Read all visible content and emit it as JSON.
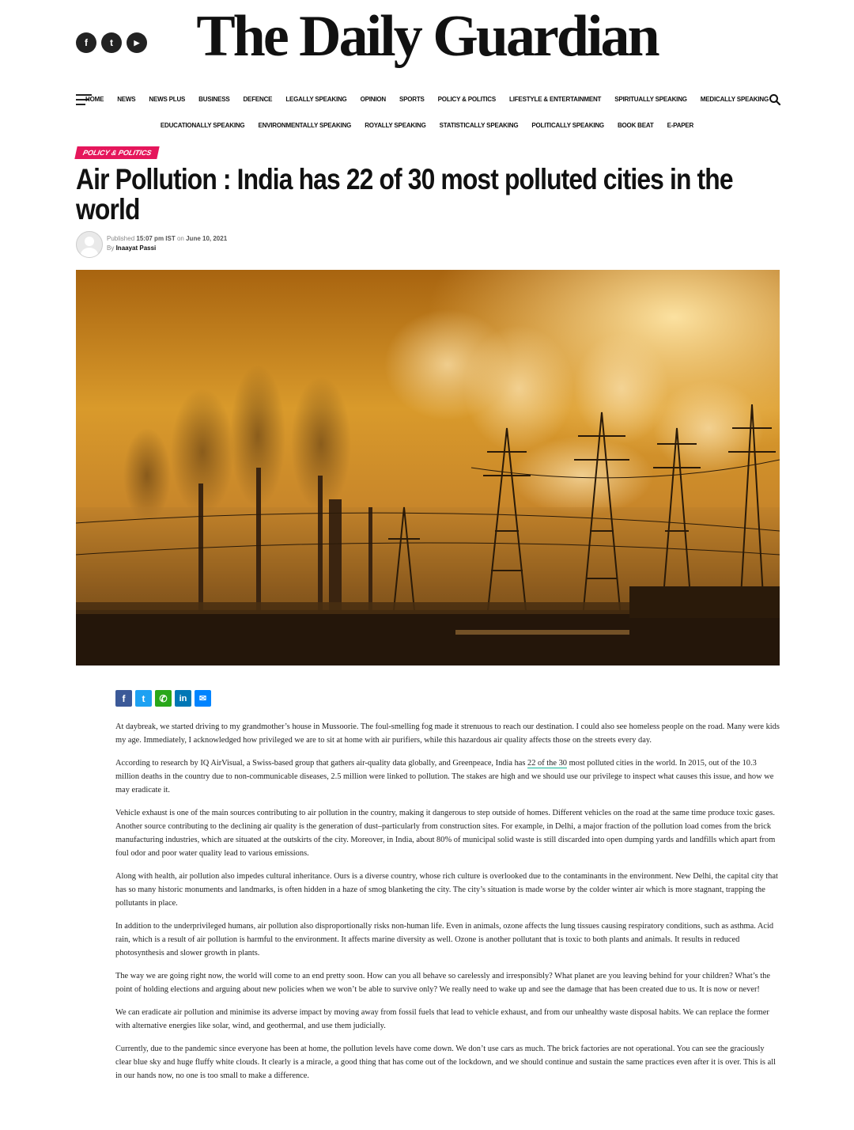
{
  "site": {
    "logo": "The Daily Guardian",
    "social": [
      {
        "icon": "facebook-icon",
        "glyph": "f"
      },
      {
        "icon": "twitter-icon",
        "glyph": "t"
      },
      {
        "icon": "youtube-icon",
        "glyph": "▶"
      }
    ]
  },
  "nav": {
    "row1": [
      "HOME",
      "NEWS",
      "NEWS PLUS",
      "BUSINESS",
      "DEFENCE",
      "LEGALLY SPEAKING",
      "OPINION",
      "SPORTS",
      "POLICY & POLITICS",
      "LIFESTYLE & ENTERTAINMENT",
      "SPIRITUALLY SPEAKING",
      "MEDICALLY SPEAKING"
    ],
    "row2": [
      "EDUCATIONALLY SPEAKING",
      "ENVIRONMENTALLY SPEAKING",
      "ROYALLY SPEAKING",
      "STATISTICALLY SPEAKING",
      "POLITICALLY SPEAKING",
      "BOOK BEAT",
      "E-PAPER"
    ]
  },
  "article": {
    "category": "POLICY & POLITICS",
    "title": "Air Pollution : India has 22 of 30 most polluted cities in the world",
    "published_label": "Published",
    "time": "15:07 pm IST",
    "on_label": "on",
    "date": "June 10, 2021",
    "by_label": "By",
    "author": "Inaayat Passi",
    "share": [
      {
        "icon": "facebook-share-icon",
        "glyph": "f",
        "color": "#3b5998"
      },
      {
        "icon": "twitter-share-icon",
        "glyph": "t",
        "color": "#1da1f2"
      },
      {
        "icon": "whatsapp-share-icon",
        "glyph": "✆",
        "color": "#29a71a"
      },
      {
        "icon": "linkedin-share-icon",
        "glyph": "in",
        "color": "#0077b5"
      },
      {
        "icon": "messenger-share-icon",
        "glyph": "✉",
        "color": "#0084ff"
      }
    ],
    "p1": "At daybreak, we started driving to my grandmother’s house in Mussoorie. The foul-smelling fog made it strenuous to reach our destination. I could also see homeless people on the road. Many were kids my age. Immediately, I acknowledged how privileged we are to sit at home with air purifiers, while this hazardous air quality affects those on the streets every day.",
    "p2_before": "According to research by IQ AirVisual, a Swiss-based group that gathers air-quality data globally, and Greenpeace, India has ",
    "p2_link": "22 of the 30",
    "p2_after": " most polluted cities in the world. In 2015, out of the 10.3 million deaths in the country due to non-communicable diseases, 2.5 million were linked to pollution. The stakes are high and we should use our privilege to inspect what causes this issue, and how we may eradicate it.",
    "p3": "Vehicle exhaust is one of the main sources contributing to air pollution in the country, making it dangerous to step outside of homes. Different vehicles on the road at the same time produce toxic gases. Another source contributing to the declining air quality is the generation of dust–particularly from construction sites. For example, in Delhi, a major fraction of the pollution load comes from the brick manufacturing industries, which are situated at the outskirts of the city. Moreover, in India, about 80% of municipal solid waste is still discarded into open dumping yards and landfills which apart from foul odor and poor water quality lead to various emissions.",
    "p4": "Along with health, air pollution also impedes cultural inheritance. Ours is a diverse country, whose rich culture is overlooked due to the contaminants in the environment. New Delhi, the capital city that has so many historic monuments and landmarks, is often hidden in a haze of smog blanketing the city. The city’s situation is made worse by the colder winter air which is more stagnant, trapping the pollutants in place.",
    "p5": "In addition to the underprivileged humans, air pollution also disproportionally risks non-human life. Even in animals, ozone affects the lung tissues causing respiratory conditions, such as asthma. Acid rain, which is a result of air pollution is harmful to the environment. It affects marine diversity as well. Ozone is another pollutant that is toxic to both plants and animals. It results in reduced photosynthesis and slower growth in plants.",
    "p6": "The way we are going right now, the world will come to an end pretty soon. How can you all behave so carelessly and irresponsibly? What planet are you leaving behind for your children? What’s the point of holding elections and arguing about new policies when we won’t be able to survive only? We really need to wake up and see the damage that has been created due to us. It is now or never!",
    "p7": "We can eradicate air pollution and minimise its adverse impact by moving away from fossil fuels that lead to vehicle exhaust, and from our unhealthy waste disposal habits.  We can replace the former with alternative energies like solar, wind, and geothermal, and use them judicially.",
    "p8": "Currently, due to the pandemic since everyone has been at home, the pollution levels have come down. We don’t use cars as much. The brick factories are not operational. You can see the graciously clear blue sky and huge fluffy white clouds. It clearly is a miracle, a good thing that has come out of the lockdown, and we should continue and sustain the same practices even after it is over. This is all in our hands now, no one is too small to make a difference."
  },
  "colors": {
    "accent": "#e5165b",
    "link_underline": "#18b79a"
  }
}
